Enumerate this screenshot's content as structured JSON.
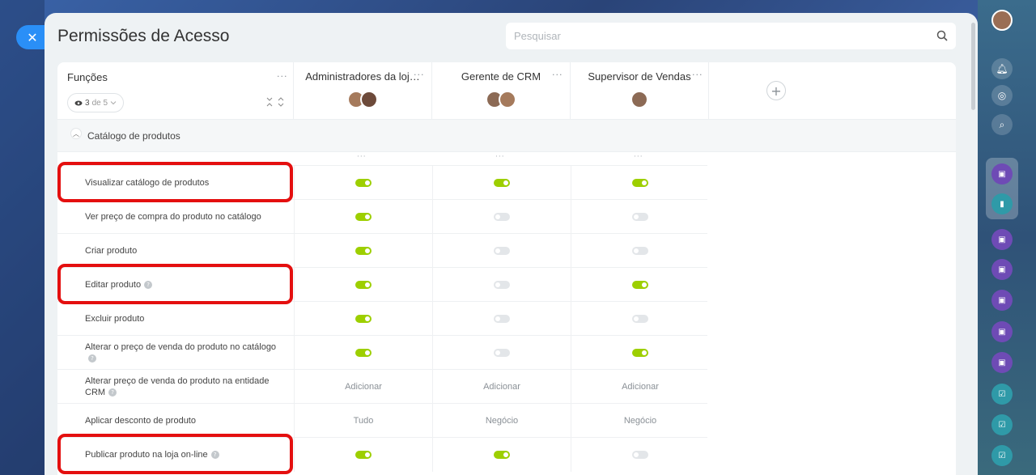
{
  "panel": {
    "title": "Permissões de Acesso"
  },
  "search": {
    "placeholder": "Pesquisar"
  },
  "table": {
    "functions_label": "Funções",
    "visible_count": "3",
    "visible_of": "de 5",
    "roles": [
      {
        "name": "Administradores da loj…"
      },
      {
        "name": "Gerente de CRM"
      },
      {
        "name": "Supervisor de Vendas"
      }
    ],
    "section": {
      "label": "Catálogo de produtos"
    },
    "rows": [
      {
        "label": "Visualizar catálogo de produtos",
        "help": false,
        "cells": [
          {
            "toggle": "on"
          },
          {
            "toggle": "on"
          },
          {
            "toggle": "on"
          }
        ]
      },
      {
        "label": "Ver preço de compra do produto no catálogo",
        "help": false,
        "cells": [
          {
            "toggle": "on"
          },
          {
            "toggle": "off"
          },
          {
            "toggle": "off"
          }
        ]
      },
      {
        "label": "Criar produto",
        "help": false,
        "cells": [
          {
            "toggle": "on"
          },
          {
            "toggle": "off"
          },
          {
            "toggle": "off"
          }
        ]
      },
      {
        "label": "Editar produto",
        "help": true,
        "cells": [
          {
            "toggle": "on"
          },
          {
            "toggle": "off"
          },
          {
            "toggle": "on"
          }
        ]
      },
      {
        "label": "Excluir produto",
        "help": false,
        "cells": [
          {
            "toggle": "on"
          },
          {
            "toggle": "off"
          },
          {
            "toggle": "off"
          }
        ]
      },
      {
        "label": "Alterar o preço de venda do produto no catálogo",
        "help": true,
        "cells": [
          {
            "toggle": "on"
          },
          {
            "toggle": "off"
          },
          {
            "toggle": "on"
          }
        ]
      },
      {
        "label": "Alterar preço de venda do produto na entidade CRM",
        "help": true,
        "cells": [
          {
            "text": "Adicionar"
          },
          {
            "text": "Adicionar"
          },
          {
            "text": "Adicionar"
          }
        ]
      },
      {
        "label": "Aplicar desconto de produto",
        "help": false,
        "cells": [
          {
            "text": "Tudo"
          },
          {
            "text": "Negócio"
          },
          {
            "text": "Negócio"
          }
        ]
      },
      {
        "label": "Publicar produto na loja on-line",
        "help": true,
        "cells": [
          {
            "toggle": "on"
          },
          {
            "toggle": "on"
          },
          {
            "toggle": "off"
          }
        ]
      }
    ]
  },
  "highlighted_rows": [
    "Visualizar catálogo de produtos",
    "Editar produto",
    "Publicar produto na loja on-line"
  ],
  "colors": {
    "accent": "#2a8ff7",
    "toggle_on": "#9dcf00",
    "toggle_off": "#e3e6e9",
    "highlight": "#e40f0f"
  }
}
